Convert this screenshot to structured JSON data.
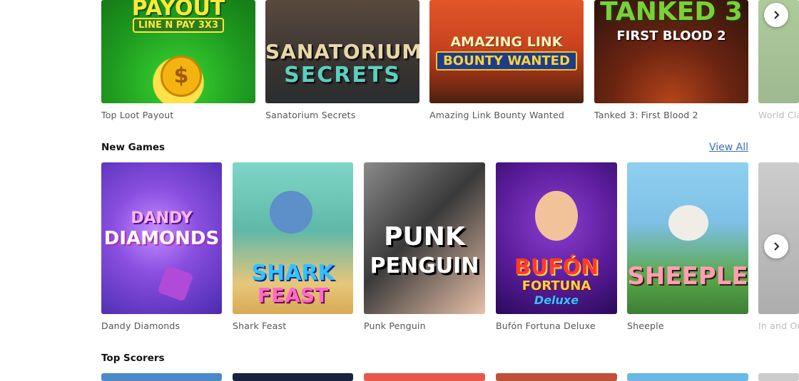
{
  "top_row": {
    "games": [
      {
        "title": "Top Loot Payout",
        "art": [
          "PAYOUT",
          "LINE N PAY 3X3"
        ]
      },
      {
        "title": "Sanatorium Secrets",
        "art": [
          "SANATORIUM",
          "SECRETS"
        ]
      },
      {
        "title": "Amazing Link Bounty Wanted",
        "art": [
          "AMAZING LINK",
          "BOUNTY WANTED"
        ]
      },
      {
        "title": "Tanked 3: First Blood 2",
        "art": [
          "TANKED 3",
          "FIRST BLOOD 2"
        ]
      },
      {
        "title": "World Cla",
        "art": []
      }
    ]
  },
  "new_games": {
    "heading": "New Games",
    "view_all": "View All",
    "games": [
      {
        "title": "Dandy Diamonds",
        "art": [
          "DANDY",
          "DIAMONDS"
        ]
      },
      {
        "title": "Shark Feast",
        "art": [
          "SHARK",
          "FEAST"
        ]
      },
      {
        "title": "Punk Penguin",
        "art": [
          "PUNK",
          "PENGUIN"
        ]
      },
      {
        "title": "Bufón Fortuna Deluxe",
        "art": [
          "BUFÓN",
          "FORTUNA",
          "Deluxe"
        ]
      },
      {
        "title": "Sheeple",
        "art": [
          "SHEEPLE"
        ]
      },
      {
        "title": "In and Ou",
        "art": []
      }
    ]
  },
  "top_scorers": {
    "heading": "Top Scorers"
  },
  "icons": {
    "next": "chevron-right-icon"
  }
}
